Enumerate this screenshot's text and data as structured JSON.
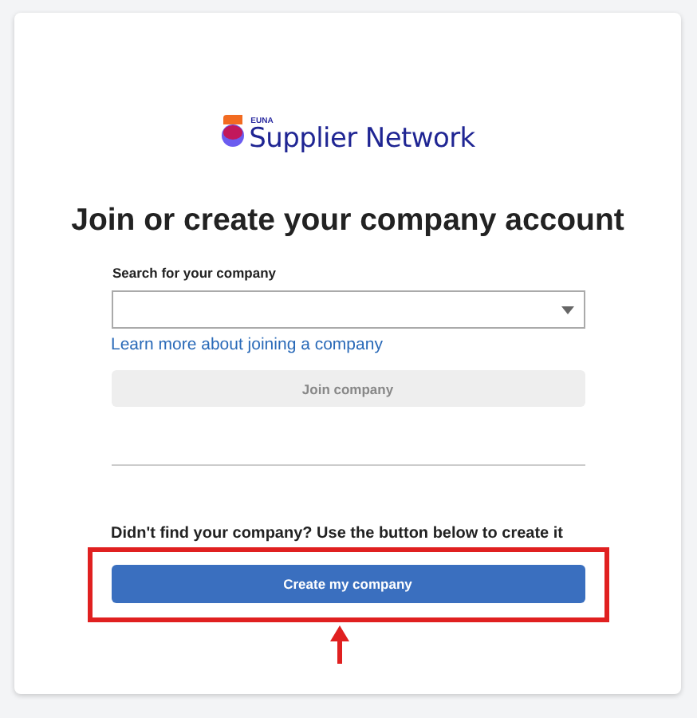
{
  "logo": {
    "brand": "EUNA",
    "name": "Supplier Network"
  },
  "heading": "Join or create your company account",
  "search": {
    "label": "Search for your company"
  },
  "link": "Learn more about joining a company",
  "join_button": {
    "label": "Join company",
    "disabled": true
  },
  "note": "Didn't find your company? Use the button below to create it",
  "create_button": {
    "label": "Create my company",
    "highlighted": true
  }
}
